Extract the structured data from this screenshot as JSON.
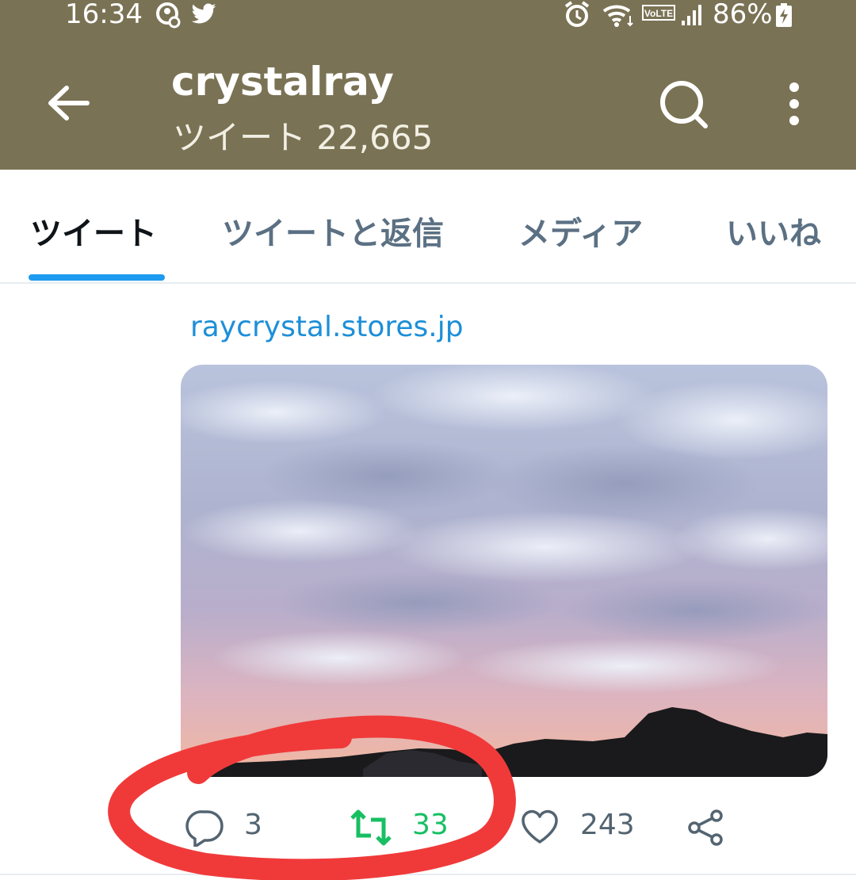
{
  "status_bar": {
    "time": "16:34",
    "battery": "86%",
    "icons": [
      "account-sync-icon",
      "twitter-icon",
      "alarm-icon",
      "wifi-icon",
      "volte-icon",
      "signal-icon",
      "battery-charging-icon"
    ],
    "volte_label": "VoLTE"
  },
  "header": {
    "title": "crystalray",
    "subtitle": "ツイート 22,665",
    "background": "#7a7254"
  },
  "tabs": [
    {
      "label": "ツイート",
      "active": true
    },
    {
      "label": "ツイートと返信",
      "active": false
    },
    {
      "label": "メディア",
      "active": false
    },
    {
      "label": "いいね",
      "active": false
    }
  ],
  "tweet": {
    "link": "raycrystal.stores.jp",
    "image_description": "sunset-sky-with-clouds",
    "actions": {
      "reply_count": "3",
      "retweet_count": "33",
      "like_count": "243"
    }
  },
  "colors": {
    "accent": "#1d9bf0",
    "link": "#1d8fd8",
    "retweet": "#17bf63",
    "muted": "#536471",
    "annotation": "#f03a3a"
  }
}
